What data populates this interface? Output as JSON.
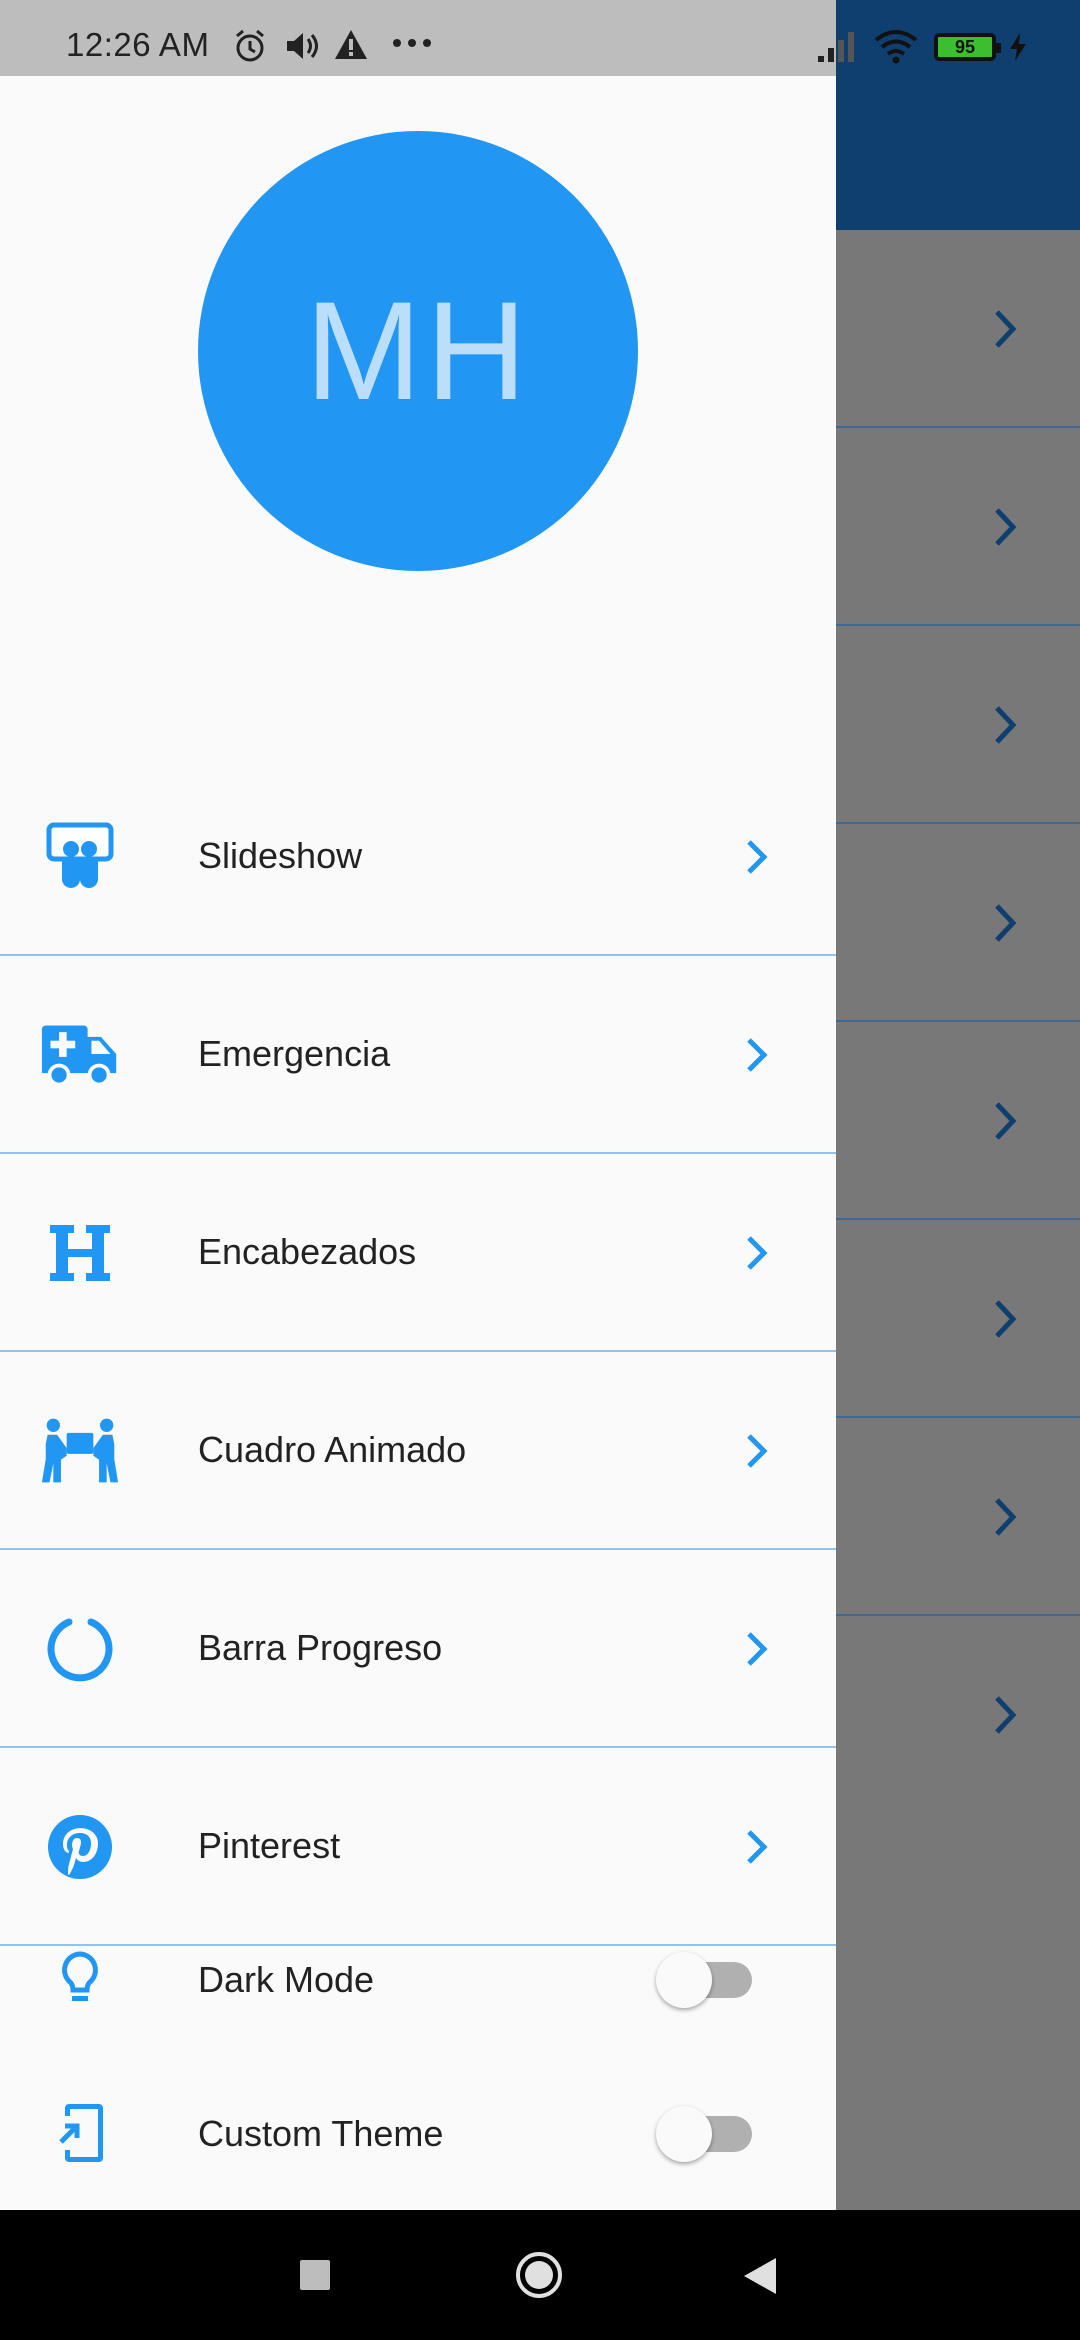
{
  "status_bar": {
    "time": "12:26 AM",
    "battery": "95",
    "icons": [
      "alarm-icon",
      "volume-icon",
      "warning-icon",
      "more-icon",
      "signal-icon",
      "wifi-icon",
      "battery-icon",
      "charging-icon"
    ]
  },
  "drawer": {
    "avatar_initials": "MH",
    "menu_items": [
      {
        "label": "Slideshow",
        "icon": "slideshare-icon"
      },
      {
        "label": "Emergencia",
        "icon": "ambulance-icon"
      },
      {
        "label": "Encabezados",
        "icon": "heading-icon"
      },
      {
        "label": "Cuadro Animado",
        "icon": "people-carry-icon"
      },
      {
        "label": "Barra Progreso",
        "icon": "circle-notch-icon"
      },
      {
        "label": "Pinterest",
        "icon": "pinterest-icon"
      }
    ],
    "settings": [
      {
        "label": "Dark Mode",
        "icon": "lightbulb-icon",
        "enabled": false
      },
      {
        "label": "Custom Theme",
        "icon": "add-to-screen-icon",
        "enabled": false
      }
    ]
  },
  "colors": {
    "accent": "#2196f3",
    "avatar_text": "#bbdefb",
    "appbar": "#0e3f6e",
    "divider": "#90c4ea"
  }
}
